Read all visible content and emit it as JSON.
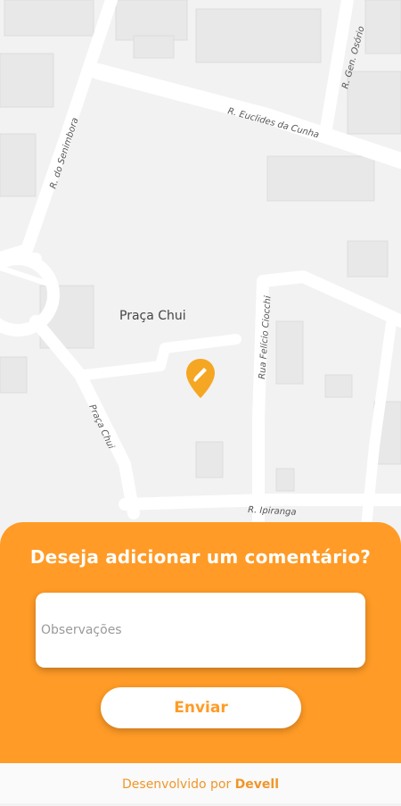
{
  "map": {
    "place_label": "Praça Chui",
    "streets": {
      "euclides": "R. Euclides da Cunha",
      "osorio": "R. Gen. Osório",
      "senimbora": "R. do Senimbora",
      "pracachui": "Praça Chui",
      "felicio": "Rua Felício Ciocchi",
      "ipiranga": "R. Ipiranga"
    },
    "pin_icon": "map-pin-icon",
    "pin_color": "#f5a623"
  },
  "sheet": {
    "title": "Deseja adicionar um comentário?",
    "observations_placeholder": "Observações",
    "observations_value": "",
    "send_label": "Enviar",
    "accent_color": "#ff9b26"
  },
  "footer": {
    "prefix": "Desenvolvido por ",
    "brand": "Devell"
  }
}
